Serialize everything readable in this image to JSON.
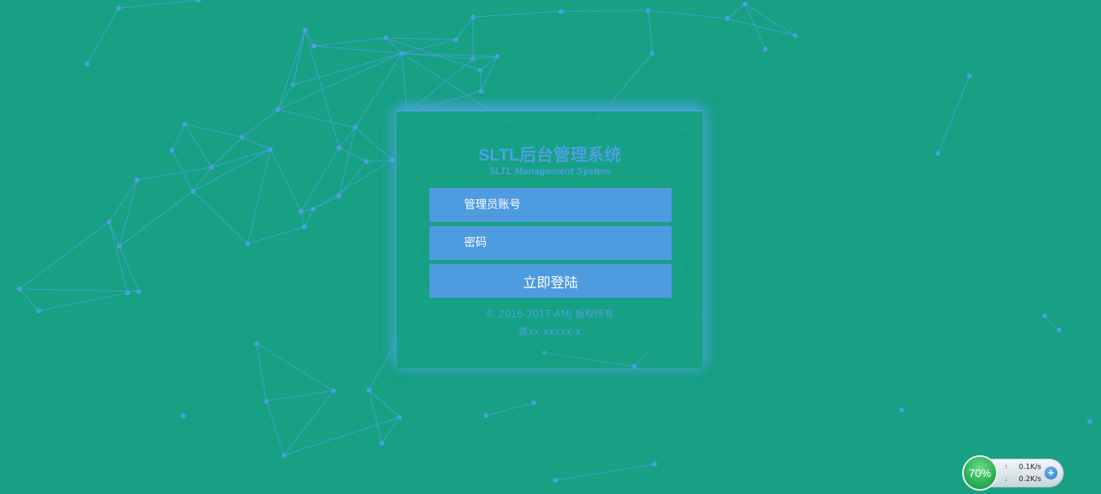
{
  "login": {
    "title": "SLTL后台管理系统",
    "subtitle": "SLTL Management System",
    "username_placeholder": "管理员账号",
    "password_placeholder": "密码",
    "login_button": "立即登陆",
    "copyright": "© 2016-2017 AMJ 版权所有",
    "icp": "黄xx-xxxxx-x"
  },
  "speed_widget": {
    "percent": "70%",
    "upload": "0.1K/s",
    "download": "0.2K/s",
    "plus_label": "+"
  },
  "colors": {
    "background": "#17a084",
    "accent": "#4f9be0",
    "network_lines": "#4b9fe1"
  }
}
